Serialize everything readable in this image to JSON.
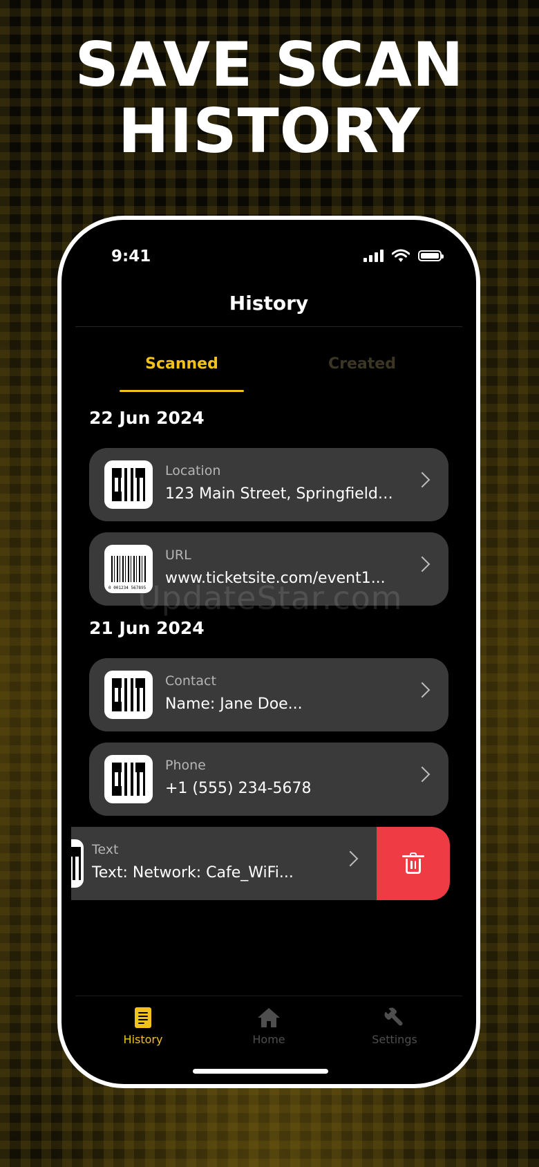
{
  "headline": {
    "line1": "SAVE SCAN",
    "line2": "HISTORY"
  },
  "status_bar": {
    "time": "9:41"
  },
  "nav": {
    "title": "History"
  },
  "tabs": [
    {
      "label": "Scanned",
      "selected": true
    },
    {
      "label": "Created",
      "selected": false
    }
  ],
  "sections": [
    {
      "date": "22 Jun 2024",
      "items": [
        {
          "type": "Location",
          "value": "123 Main Street, Springfield,...",
          "thumb": "qr-code-icon"
        },
        {
          "type": "URL",
          "value": "www.ticketsite.com/event1...",
          "thumb": "barcode-icon",
          "barcode_digits": "0 001234 567895"
        }
      ]
    },
    {
      "date": "21 Jun 2024",
      "items": [
        {
          "type": "Contact",
          "value": "Name: Jane Doe...",
          "thumb": "qr-code-icon"
        },
        {
          "type": "Phone",
          "value": "+1 (555) 234-5678",
          "thumb": "qr-code-icon"
        },
        {
          "type": "Text",
          "value": "Text: Network: Cafe_WiFi...",
          "thumb": "qr-code-icon",
          "swiped": true
        }
      ]
    }
  ],
  "watermark": "UpdateStar.com",
  "bottom_tabs": [
    {
      "label": "History",
      "icon": "document-icon",
      "active": true
    },
    {
      "label": "Home",
      "icon": "home-icon",
      "active": false
    },
    {
      "label": "Settings",
      "icon": "wrench-icon",
      "active": false
    }
  ],
  "colors": {
    "accent": "#f2c21b",
    "card": "#3a3a3a",
    "delete": "#ee3b44",
    "background": "#000000"
  }
}
